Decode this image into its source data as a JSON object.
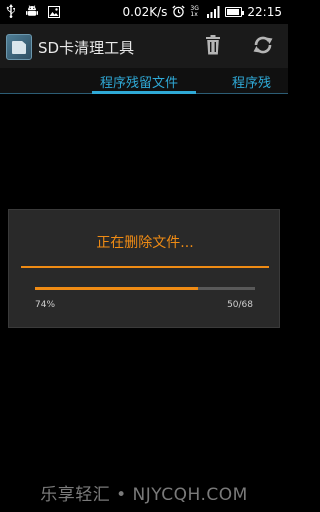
{
  "status_bar": {
    "icons": [
      "usb-icon",
      "android-debug-icon",
      "image-notification-icon",
      "alarm-icon",
      "signal-icon",
      "battery-icon"
    ],
    "network_speed": "0.02K/s",
    "network_type_top": "3G",
    "network_type_bottom": "1x",
    "battery_level": 0.9,
    "time": "22:15"
  },
  "action_bar": {
    "app_title": "SD卡清理工具",
    "icons": [
      "app-icon",
      "trash-icon",
      "refresh-icon"
    ]
  },
  "tabs": [
    {
      "label": "程序残留文件",
      "selected": true
    },
    {
      "label": "程序残",
      "selected": false
    }
  ],
  "dialog": {
    "title": "正在删除文件...",
    "progress_fraction": 0.74,
    "progress_percent": "74%",
    "progress_count": "50/68"
  },
  "colors": {
    "accent_orange": "#ef8b14",
    "tab_blue": "#2fa9d6"
  },
  "watermark": "乐享轻汇 • NJYCQH.COM"
}
